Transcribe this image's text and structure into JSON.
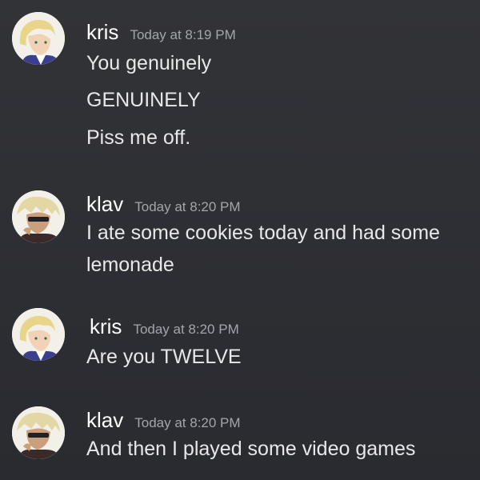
{
  "messages": [
    {
      "author": "kris",
      "timestamp": "Today at 8:19 PM",
      "lines": [
        "You genuinely",
        "GENUINELY",
        "Piss me off."
      ]
    },
    {
      "author": "klav",
      "timestamp": "Today at 8:20 PM",
      "lines": [
        "I ate some cookies today and had some",
        "lemonade"
      ]
    },
    {
      "author": "kris",
      "timestamp": "Today at 8:20 PM",
      "lines": [
        "Are you TWELVE"
      ]
    },
    {
      "author": "klav",
      "timestamp": "Today at 8:20 PM",
      "lines": [
        "And then I played some video games"
      ]
    }
  ],
  "colors": {
    "background": "#2f3033",
    "username": "#ffffff",
    "timestamp": "#a3a5ab",
    "message_text": "#e8e8ea"
  }
}
